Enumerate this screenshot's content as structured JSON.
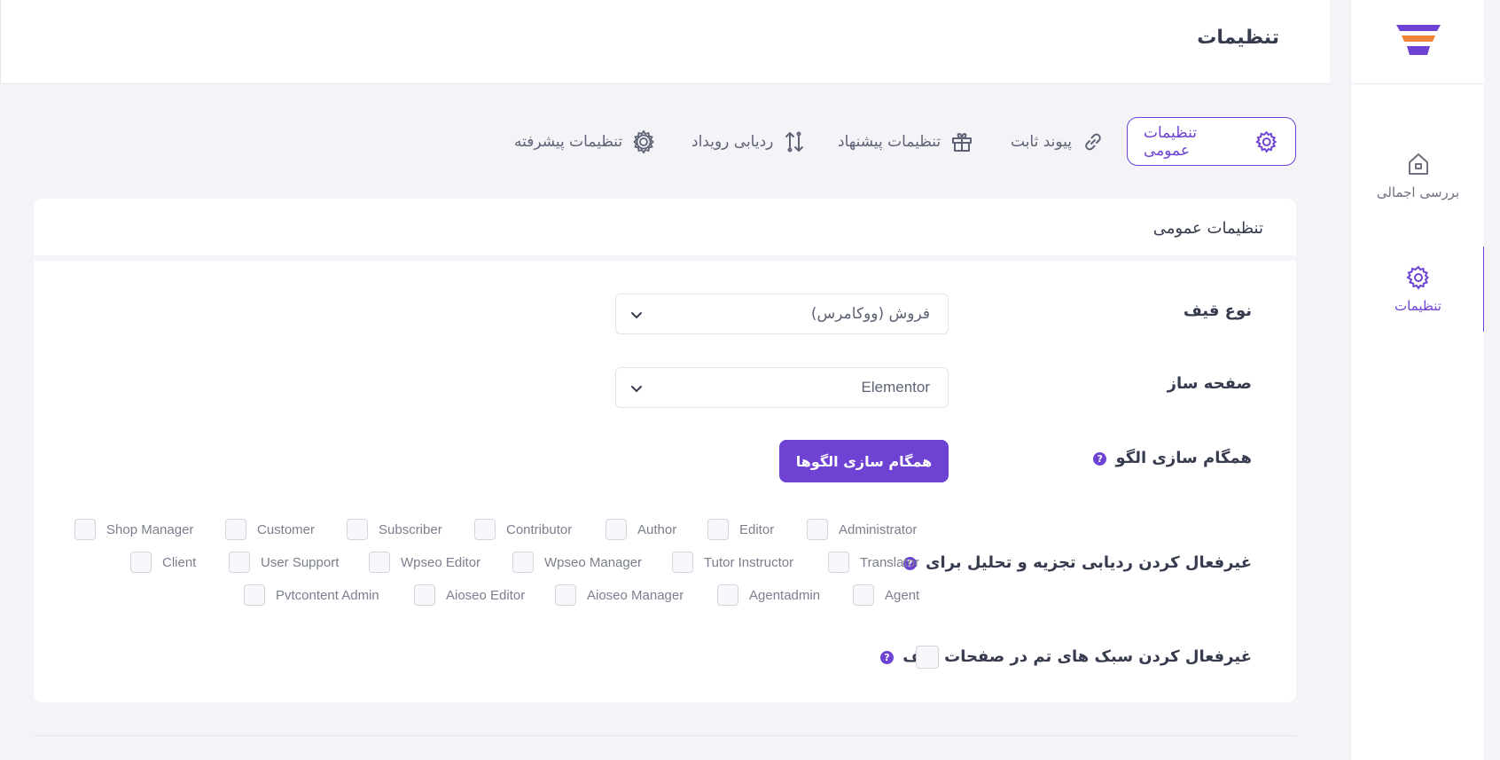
{
  "header": {
    "title": "تنظیمات"
  },
  "sidebar": {
    "items": [
      {
        "label": "بررسی اجمالی",
        "icon": "home-icon"
      },
      {
        "label": "تنظیمات",
        "icon": "gear-icon",
        "active": true
      }
    ]
  },
  "tabs": [
    {
      "label": "تنظیمات عمومی",
      "icon": "gear-icon",
      "active": true
    },
    {
      "label": "پیوند ثابت",
      "icon": "link-icon"
    },
    {
      "label": "تنظیمات پیشنهاد",
      "icon": "gift-icon"
    },
    {
      "label": "ردیابی رویداد",
      "icon": "swap-icon"
    },
    {
      "label": "تنظیمات پیشرفته",
      "icon": "gears-icon"
    }
  ],
  "card": {
    "title": "تنظیمات عمومی",
    "funnel_type": {
      "label": "نوع قیف",
      "value": "فروش (ووکامرس)"
    },
    "page_builder": {
      "label": "صفحه ساز",
      "value": "Elementor"
    },
    "template_sync": {
      "label": "همگام سازی الگو",
      "button": "همگام سازی الگوها",
      "help": "?"
    },
    "disable_tracking": {
      "label": "غیرفعال کردن ردیابی تجزیه و تحلیل برای",
      "help": "?",
      "roles_row1": [
        "Administrator",
        "Editor",
        "Author",
        "Contributor",
        "Subscriber",
        "Customer",
        "Shop Manager"
      ],
      "roles_row2": [
        "Translator",
        "Tutor Instructor",
        "Wpseo Manager",
        "Wpseo Editor",
        "User Support",
        "Client"
      ],
      "roles_row3": [
        "Agent",
        "Agentadmin",
        "Aioseo Manager",
        "Aioseo Editor",
        "Pvtcontent Admin"
      ]
    },
    "disable_theme_styles": {
      "label": "غیرفعال کردن سبک های تم در صفحات قیف",
      "help": "?"
    }
  },
  "colors": {
    "accent": "#6e42d3",
    "logo_orange": "#f0833a",
    "background": "#f4f4f8"
  }
}
